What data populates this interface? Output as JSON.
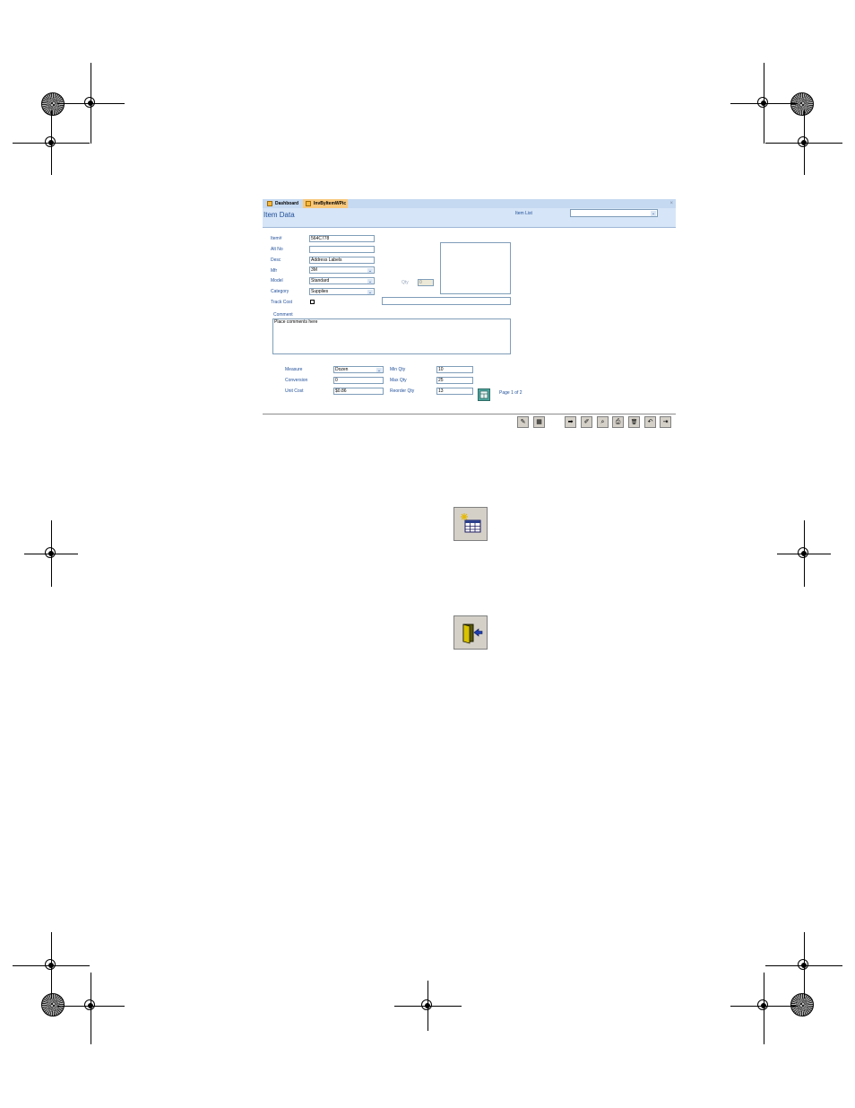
{
  "tabs": [
    {
      "label": "Dashboard",
      "active": false
    },
    {
      "label": "InvByItemWPic",
      "active": true
    }
  ],
  "close_symbol": "×",
  "header": {
    "title": "Item Data",
    "item_list_label": "Item List",
    "item_list_value": ""
  },
  "form": {
    "item_no": {
      "label": "Item#",
      "value": "564C778"
    },
    "alt_no": {
      "label": "Alt No",
      "value": ""
    },
    "desc": {
      "label": "Desc",
      "value": "Address Labels"
    },
    "mfr": {
      "label": "Mfr",
      "value": "3M"
    },
    "model": {
      "label": "Model",
      "value": "Standard"
    },
    "category": {
      "label": "Category",
      "value": "Supplies"
    },
    "track_cost": {
      "label": "Track Cost",
      "checked": false
    },
    "qty": {
      "label": "Qty",
      "value": "0"
    },
    "comment": {
      "label": "Comment",
      "value": "Place comments here"
    },
    "measure": {
      "label": "Measure",
      "value": "Dozen"
    },
    "conversion": {
      "label": "Conversion",
      "value": "0"
    },
    "unit_cost": {
      "label": "Unit Cost",
      "value": "$0.86"
    },
    "min_qty": {
      "label": "Min Qty",
      "value": "10"
    },
    "max_qty": {
      "label": "Max Qty",
      "value": "25"
    },
    "reorder_qty": {
      "label": "Reorder Qty",
      "value": "13"
    },
    "page_indicator": "Page 1 of 2"
  },
  "toolbar": {
    "buttons": [
      {
        "icon": "new-record-icon",
        "glyph": "✎"
      },
      {
        "icon": "new-table-icon",
        "glyph": "▦"
      },
      {
        "icon": "next-arrow-icon",
        "glyph": "➡"
      },
      {
        "icon": "edit-icon",
        "glyph": "✐"
      },
      {
        "icon": "find-icon",
        "glyph": "⌕"
      },
      {
        "icon": "print-icon",
        "glyph": "⎙"
      },
      {
        "icon": "delete-icon",
        "glyph": "🗑"
      },
      {
        "icon": "undo-icon",
        "glyph": "↶"
      },
      {
        "icon": "exit-icon",
        "glyph": "⇥"
      }
    ]
  },
  "callout_icons": [
    "new-table-icon",
    "exit-door-icon"
  ],
  "colors": {
    "accent": "#1f4e99",
    "header_bg": "#d6e5f7",
    "tab_bg": "#c5d9f1",
    "active_tab": "#f8c77a"
  }
}
